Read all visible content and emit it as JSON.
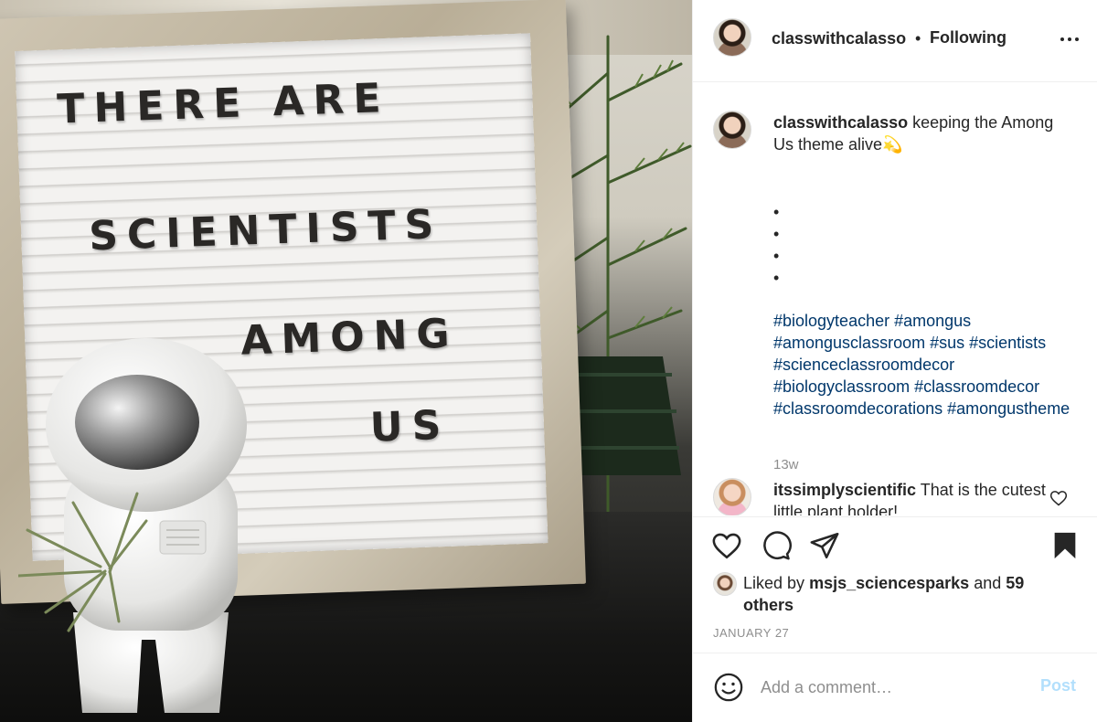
{
  "post": {
    "image": {
      "board_lines": [
        "THERE ARE",
        "SCIENTISTS",
        "AMONG",
        "US"
      ]
    },
    "header": {
      "username": "classwithcalasso",
      "separator": "•",
      "follow_status": "Following"
    },
    "caption": {
      "username": "classwithcalasso",
      "text": "keeping the Among Us theme alive💫",
      "bullets": [
        "•",
        "•",
        "•",
        "•"
      ],
      "hashtags": [
        "#biologyteacher",
        "#amongus",
        "#amongusclassroom",
        "#sus",
        "#scientists",
        "#scienceclassroomdecor",
        "#biologyclassroom",
        "#classroomdecor",
        "#classroomdecorations",
        "#amongustheme"
      ],
      "age": "13w"
    },
    "comments": [
      {
        "username": "itssimplyscientific",
        "text": "That is the cutest little plant holder!"
      }
    ],
    "likes": {
      "prefix": "Liked by",
      "user": "msjs_sciencesparks",
      "joiner": "and",
      "others": "59 others"
    },
    "date": "JANUARY 27",
    "add_comment": {
      "placeholder": "Add a comment…",
      "post_label": "Post"
    },
    "icons": {
      "like": "heart-icon",
      "comment": "comment-icon",
      "share": "paper-plane-icon",
      "save": "bookmark-icon",
      "emoji": "smiley-icon",
      "more": "more-options-icon"
    },
    "colors": {
      "hashtag": "#00376b",
      "post_button_disabled": "#b2dffc",
      "muted_text": "#8e8e8e"
    }
  }
}
